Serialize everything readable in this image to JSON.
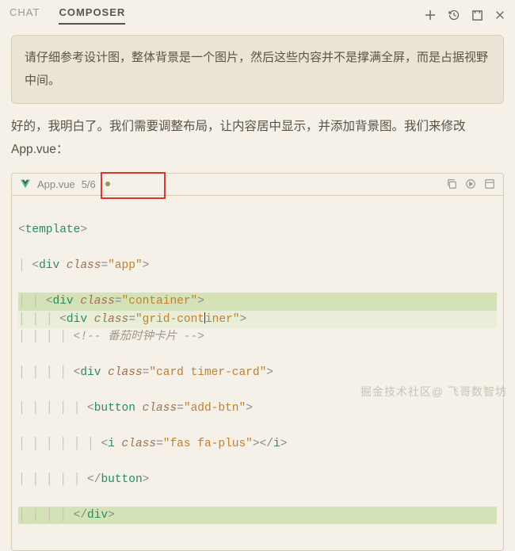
{
  "tabs": {
    "chat": "CHAT",
    "composer": "COMPOSER"
  },
  "prompt": "请仔细参考设计图，整体背景是一个图片，然后这些内容并不是撑满全屏，而是占据视野中间。",
  "response": "好的，我明白了。我们需要调整布局，让内容居中显示，并添加背景图。我们来修改 App.vue：",
  "file": {
    "name": "App.vue",
    "progress": "5/6"
  },
  "code": {
    "l1a": "<",
    "l1b": "template",
    "l1c": ">",
    "l2a": "<",
    "l2b": "div",
    "l2c": " class",
    "l2d": "=",
    "l2e": "\"app\"",
    "l2f": ">",
    "l3a": "<",
    "l3b": "div",
    "l3c": " class",
    "l3d": "=",
    "l3e": "\"container\"",
    "l3f": ">",
    "l4a": "<",
    "l4b": "div",
    "l4c": " class",
    "l4d": "=",
    "l4e1": "\"grid-cont",
    "l4e2": "iner\"",
    "l4f": ">",
    "l5a": "<!-- ",
    "l5b": "番茄时钟卡片",
    "l5c": " -->",
    "l6a": "<",
    "l6b": "div",
    "l6c": " class",
    "l6d": "=",
    "l6e": "\"card timer-card\"",
    "l6f": ">",
    "l7a": "<",
    "l7b": "button",
    "l7c": " class",
    "l7d": "=",
    "l7e": "\"add-btn\"",
    "l7f": ">",
    "l8a": "<",
    "l8b": "i",
    "l8c": " class",
    "l8d": "=",
    "l8e": "\"fas fa-plus\"",
    "l8f": "></",
    "l8g": "i",
    "l8h": ">",
    "l9a": "</",
    "l9b": "button",
    "l9c": ">",
    "l10a": "</",
    "l10b": "div",
    "l10c": ">"
  },
  "watermark": "掘金技术社区@ 飞哥数智坊",
  "indent": {
    "g1": "│ ",
    "i2": "  ",
    "i4": "    ",
    "i6": "      ",
    "i8": "        "
  }
}
